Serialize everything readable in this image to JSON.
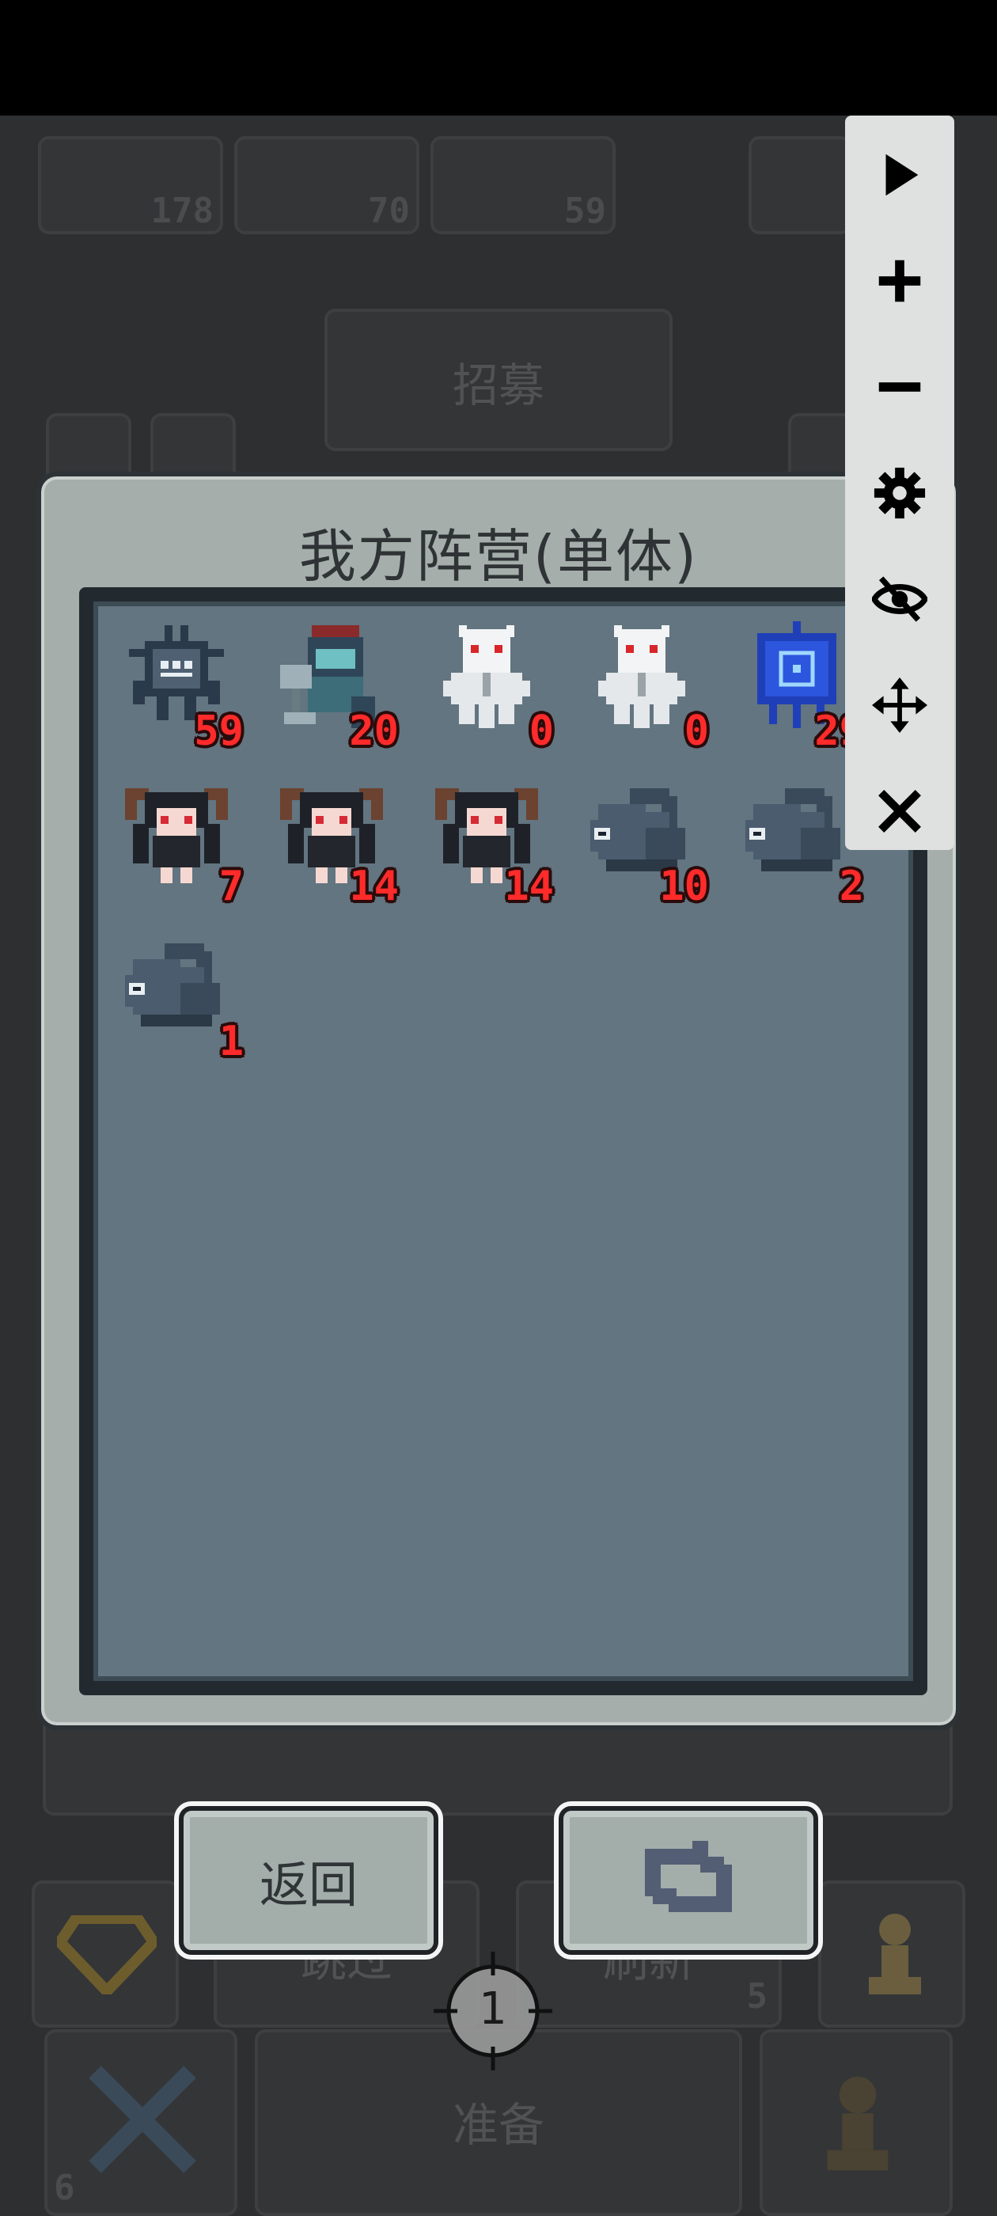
{
  "top_resources": [
    {
      "icon": "sword-icon",
      "count": "178"
    },
    {
      "icon": "demon-icon",
      "count": "70"
    },
    {
      "icon": "blob-icon",
      "count": "59"
    }
  ],
  "recruit_label": "招募",
  "dialog": {
    "title": "我方阵营(单体)",
    "units": [
      {
        "icon": "spider-monster-icon",
        "count": "59"
      },
      {
        "icon": "armored-hammer-knight-icon",
        "count": "20"
      },
      {
        "icon": "white-ghost-icon",
        "count": "0"
      },
      {
        "icon": "white-ghost-icon",
        "count": "0"
      },
      {
        "icon": "blue-banner-icon",
        "count": "29"
      },
      {
        "icon": "horned-demon-girl-icon",
        "count": "7"
      },
      {
        "icon": "horned-demon-girl-icon",
        "count": "14"
      },
      {
        "icon": "horned-demon-girl-icon",
        "count": "14"
      },
      {
        "icon": "dark-slug-icon",
        "count": "10"
      },
      {
        "icon": "dark-slug-icon",
        "count": "2"
      },
      {
        "icon": "dark-slug-icon",
        "count": "1"
      }
    ]
  },
  "buttons": {
    "back_label": "返回",
    "refresh_icon": "swap-arrows-icon"
  },
  "background": {
    "skip_label": "跳过",
    "refresh_label": "刷新",
    "refresh_cost": "5",
    "start_label": "准备",
    "bottom_left_count": "6",
    "crosshair_number": "1"
  },
  "toolbar": [
    "play-icon",
    "plus-icon",
    "minus-icon",
    "gear-icon",
    "eye-slash-icon",
    "move-icon",
    "close-icon"
  ],
  "colors": {
    "count_red": "#ff2b2b",
    "panel_bg": "#627580",
    "dialog_frame": "#a5aeab"
  }
}
